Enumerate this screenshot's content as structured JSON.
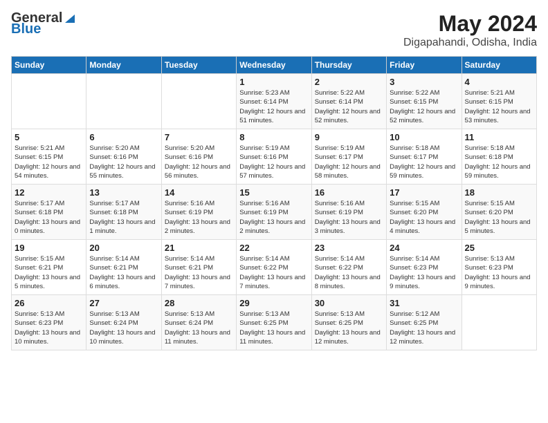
{
  "logo": {
    "general": "General",
    "blue": "Blue"
  },
  "title": {
    "month": "May 2024",
    "location": "Digapahandi, Odisha, India"
  },
  "headers": [
    "Sunday",
    "Monday",
    "Tuesday",
    "Wednesday",
    "Thursday",
    "Friday",
    "Saturday"
  ],
  "weeks": [
    [
      {
        "day": "",
        "sunrise": "",
        "sunset": "",
        "daylight": ""
      },
      {
        "day": "",
        "sunrise": "",
        "sunset": "",
        "daylight": ""
      },
      {
        "day": "",
        "sunrise": "",
        "sunset": "",
        "daylight": ""
      },
      {
        "day": "1",
        "sunrise": "Sunrise: 5:23 AM",
        "sunset": "Sunset: 6:14 PM",
        "daylight": "Daylight: 12 hours and 51 minutes."
      },
      {
        "day": "2",
        "sunrise": "Sunrise: 5:22 AM",
        "sunset": "Sunset: 6:14 PM",
        "daylight": "Daylight: 12 hours and 52 minutes."
      },
      {
        "day": "3",
        "sunrise": "Sunrise: 5:22 AM",
        "sunset": "Sunset: 6:15 PM",
        "daylight": "Daylight: 12 hours and 52 minutes."
      },
      {
        "day": "4",
        "sunrise": "Sunrise: 5:21 AM",
        "sunset": "Sunset: 6:15 PM",
        "daylight": "Daylight: 12 hours and 53 minutes."
      }
    ],
    [
      {
        "day": "5",
        "sunrise": "Sunrise: 5:21 AM",
        "sunset": "Sunset: 6:15 PM",
        "daylight": "Daylight: 12 hours and 54 minutes."
      },
      {
        "day": "6",
        "sunrise": "Sunrise: 5:20 AM",
        "sunset": "Sunset: 6:16 PM",
        "daylight": "Daylight: 12 hours and 55 minutes."
      },
      {
        "day": "7",
        "sunrise": "Sunrise: 5:20 AM",
        "sunset": "Sunset: 6:16 PM",
        "daylight": "Daylight: 12 hours and 56 minutes."
      },
      {
        "day": "8",
        "sunrise": "Sunrise: 5:19 AM",
        "sunset": "Sunset: 6:16 PM",
        "daylight": "Daylight: 12 hours and 57 minutes."
      },
      {
        "day": "9",
        "sunrise": "Sunrise: 5:19 AM",
        "sunset": "Sunset: 6:17 PM",
        "daylight": "Daylight: 12 hours and 58 minutes."
      },
      {
        "day": "10",
        "sunrise": "Sunrise: 5:18 AM",
        "sunset": "Sunset: 6:17 PM",
        "daylight": "Daylight: 12 hours and 59 minutes."
      },
      {
        "day": "11",
        "sunrise": "Sunrise: 5:18 AM",
        "sunset": "Sunset: 6:18 PM",
        "daylight": "Daylight: 12 hours and 59 minutes."
      }
    ],
    [
      {
        "day": "12",
        "sunrise": "Sunrise: 5:17 AM",
        "sunset": "Sunset: 6:18 PM",
        "daylight": "Daylight: 13 hours and 0 minutes."
      },
      {
        "day": "13",
        "sunrise": "Sunrise: 5:17 AM",
        "sunset": "Sunset: 6:18 PM",
        "daylight": "Daylight: 13 hours and 1 minute."
      },
      {
        "day": "14",
        "sunrise": "Sunrise: 5:16 AM",
        "sunset": "Sunset: 6:19 PM",
        "daylight": "Daylight: 13 hours and 2 minutes."
      },
      {
        "day": "15",
        "sunrise": "Sunrise: 5:16 AM",
        "sunset": "Sunset: 6:19 PM",
        "daylight": "Daylight: 13 hours and 2 minutes."
      },
      {
        "day": "16",
        "sunrise": "Sunrise: 5:16 AM",
        "sunset": "Sunset: 6:19 PM",
        "daylight": "Daylight: 13 hours and 3 minutes."
      },
      {
        "day": "17",
        "sunrise": "Sunrise: 5:15 AM",
        "sunset": "Sunset: 6:20 PM",
        "daylight": "Daylight: 13 hours and 4 minutes."
      },
      {
        "day": "18",
        "sunrise": "Sunrise: 5:15 AM",
        "sunset": "Sunset: 6:20 PM",
        "daylight": "Daylight: 13 hours and 5 minutes."
      }
    ],
    [
      {
        "day": "19",
        "sunrise": "Sunrise: 5:15 AM",
        "sunset": "Sunset: 6:21 PM",
        "daylight": "Daylight: 13 hours and 5 minutes."
      },
      {
        "day": "20",
        "sunrise": "Sunrise: 5:14 AM",
        "sunset": "Sunset: 6:21 PM",
        "daylight": "Daylight: 13 hours and 6 minutes."
      },
      {
        "day": "21",
        "sunrise": "Sunrise: 5:14 AM",
        "sunset": "Sunset: 6:21 PM",
        "daylight": "Daylight: 13 hours and 7 minutes."
      },
      {
        "day": "22",
        "sunrise": "Sunrise: 5:14 AM",
        "sunset": "Sunset: 6:22 PM",
        "daylight": "Daylight: 13 hours and 7 minutes."
      },
      {
        "day": "23",
        "sunrise": "Sunrise: 5:14 AM",
        "sunset": "Sunset: 6:22 PM",
        "daylight": "Daylight: 13 hours and 8 minutes."
      },
      {
        "day": "24",
        "sunrise": "Sunrise: 5:14 AM",
        "sunset": "Sunset: 6:23 PM",
        "daylight": "Daylight: 13 hours and 9 minutes."
      },
      {
        "day": "25",
        "sunrise": "Sunrise: 5:13 AM",
        "sunset": "Sunset: 6:23 PM",
        "daylight": "Daylight: 13 hours and 9 minutes."
      }
    ],
    [
      {
        "day": "26",
        "sunrise": "Sunrise: 5:13 AM",
        "sunset": "Sunset: 6:23 PM",
        "daylight": "Daylight: 13 hours and 10 minutes."
      },
      {
        "day": "27",
        "sunrise": "Sunrise: 5:13 AM",
        "sunset": "Sunset: 6:24 PM",
        "daylight": "Daylight: 13 hours and 10 minutes."
      },
      {
        "day": "28",
        "sunrise": "Sunrise: 5:13 AM",
        "sunset": "Sunset: 6:24 PM",
        "daylight": "Daylight: 13 hours and 11 minutes."
      },
      {
        "day": "29",
        "sunrise": "Sunrise: 5:13 AM",
        "sunset": "Sunset: 6:25 PM",
        "daylight": "Daylight: 13 hours and 11 minutes."
      },
      {
        "day": "30",
        "sunrise": "Sunrise: 5:13 AM",
        "sunset": "Sunset: 6:25 PM",
        "daylight": "Daylight: 13 hours and 12 minutes."
      },
      {
        "day": "31",
        "sunrise": "Sunrise: 5:12 AM",
        "sunset": "Sunset: 6:25 PM",
        "daylight": "Daylight: 13 hours and 12 minutes."
      },
      {
        "day": "",
        "sunrise": "",
        "sunset": "",
        "daylight": ""
      }
    ]
  ]
}
